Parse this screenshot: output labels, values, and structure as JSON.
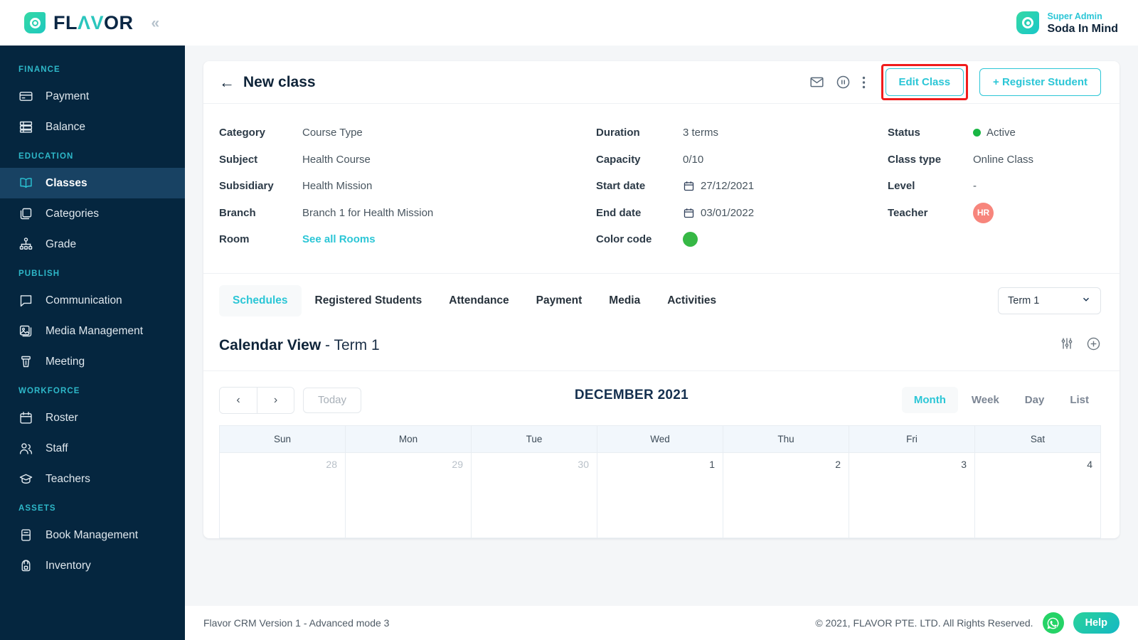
{
  "brand": {
    "name_dark_1": "FL",
    "name_teal": "ΛV",
    "name_dark_2": "OR",
    "full": "FLAVOR",
    "collapse_icon": "«"
  },
  "topbar": {
    "role": "Super Admin",
    "org": "Soda In Mind"
  },
  "sidebar": {
    "sections": [
      {
        "label": "FINANCE",
        "items": [
          {
            "label": "Payment",
            "icon": "credit-card-icon",
            "active": false
          },
          {
            "label": "Balance",
            "icon": "balance-icon",
            "active": false
          }
        ]
      },
      {
        "label": "EDUCATION",
        "items": [
          {
            "label": "Classes",
            "icon": "book-icon",
            "active": true
          },
          {
            "label": "Categories",
            "icon": "categories-icon",
            "active": false
          },
          {
            "label": "Grade",
            "icon": "grade-icon",
            "active": false
          }
        ]
      },
      {
        "label": "PUBLISH",
        "items": [
          {
            "label": "Communication",
            "icon": "chat-icon",
            "active": false
          },
          {
            "label": "Media Management",
            "icon": "media-icon",
            "active": false
          },
          {
            "label": "Meeting",
            "icon": "podium-icon",
            "active": false
          }
        ]
      },
      {
        "label": "WORKFORCE",
        "items": [
          {
            "label": "Roster",
            "icon": "calendar-icon",
            "active": false
          },
          {
            "label": "Staff",
            "icon": "users-icon",
            "active": false
          },
          {
            "label": "Teachers",
            "icon": "graduation-cap-icon",
            "active": false
          }
        ]
      },
      {
        "label": "ASSETS",
        "items": [
          {
            "label": "Book Management",
            "icon": "book-asset-icon",
            "active": false
          },
          {
            "label": "Inventory",
            "icon": "backpack-icon",
            "active": false
          }
        ]
      }
    ]
  },
  "page": {
    "title": "New class",
    "back_icon": "←",
    "actions": {
      "mail_icon": "mail-icon",
      "pause_icon": "pause-circle-icon",
      "more_icon": "more-vertical-icon",
      "edit_class": "Edit Class",
      "register_student": "+ Register Student"
    }
  },
  "details": {
    "column_left": [
      {
        "label": "Category",
        "value": "Course Type",
        "type": "text"
      },
      {
        "label": "Subject",
        "value": "Health Course",
        "type": "text"
      },
      {
        "label": "Subsidiary",
        "value": "Health Mission",
        "type": "text"
      },
      {
        "label": "Branch",
        "value": "Branch 1 for Health Mission",
        "type": "text"
      },
      {
        "label": "Room",
        "value": "See all Rooms",
        "type": "link"
      }
    ],
    "column_middle": [
      {
        "label": "Duration",
        "value": "3 terms",
        "type": "text"
      },
      {
        "label": "Capacity",
        "value": "0/10",
        "type": "text"
      },
      {
        "label": "Start date",
        "value": "27/12/2021",
        "type": "date"
      },
      {
        "label": "End date",
        "value": "03/01/2022",
        "type": "date"
      },
      {
        "label": "Color code",
        "value": "",
        "type": "swatch",
        "color": "#36b845"
      }
    ],
    "column_right": [
      {
        "label": "Status",
        "value": "Active",
        "type": "status",
        "color": "#19b644"
      },
      {
        "label": "Class type",
        "value": "Online Class",
        "type": "text"
      },
      {
        "label": "Level",
        "value": "-",
        "type": "text"
      },
      {
        "label": "Teacher",
        "value": "HR",
        "type": "avatar",
        "color": "#f7857c"
      }
    ]
  },
  "tabs": [
    {
      "label": "Schedules",
      "active": true
    },
    {
      "label": "Registered Students",
      "active": false
    },
    {
      "label": "Attendance",
      "active": false
    },
    {
      "label": "Payment",
      "active": false
    },
    {
      "label": "Media",
      "active": false
    },
    {
      "label": "Activities",
      "active": false
    }
  ],
  "term_select": {
    "value": "Term 1",
    "chevron": "⌄"
  },
  "calendar_section": {
    "title_bold": "Calendar View",
    "title_rest": " - Term 1",
    "filter_icon": "sliders-icon",
    "add_icon": "plus-circle-icon"
  },
  "calendar": {
    "prev_icon": "‹",
    "next_icon": "›",
    "today_label": "Today",
    "month_label": "DECEMBER 2021",
    "views": [
      {
        "label": "Month",
        "active": true
      },
      {
        "label": "Week",
        "active": false
      },
      {
        "label": "Day",
        "active": false
      },
      {
        "label": "List",
        "active": false
      }
    ],
    "weekdays": [
      "Sun",
      "Mon",
      "Tue",
      "Wed",
      "Thu",
      "Fri",
      "Sat"
    ],
    "weeks": [
      [
        {
          "day": "28",
          "other_month": true
        },
        {
          "day": "29",
          "other_month": true
        },
        {
          "day": "30",
          "other_month": true
        },
        {
          "day": "1",
          "other_month": false
        },
        {
          "day": "2",
          "other_month": false
        },
        {
          "day": "3",
          "other_month": false
        },
        {
          "day": "4",
          "other_month": false
        }
      ]
    ]
  },
  "footer": {
    "left": "Flavor CRM Version 1 - Advanced mode 3",
    "right": "© 2021, FLAVOR PTE. LTD. All Rights Reserved.",
    "whatsapp_icon": "whatsapp-icon",
    "help_label": "Help"
  }
}
